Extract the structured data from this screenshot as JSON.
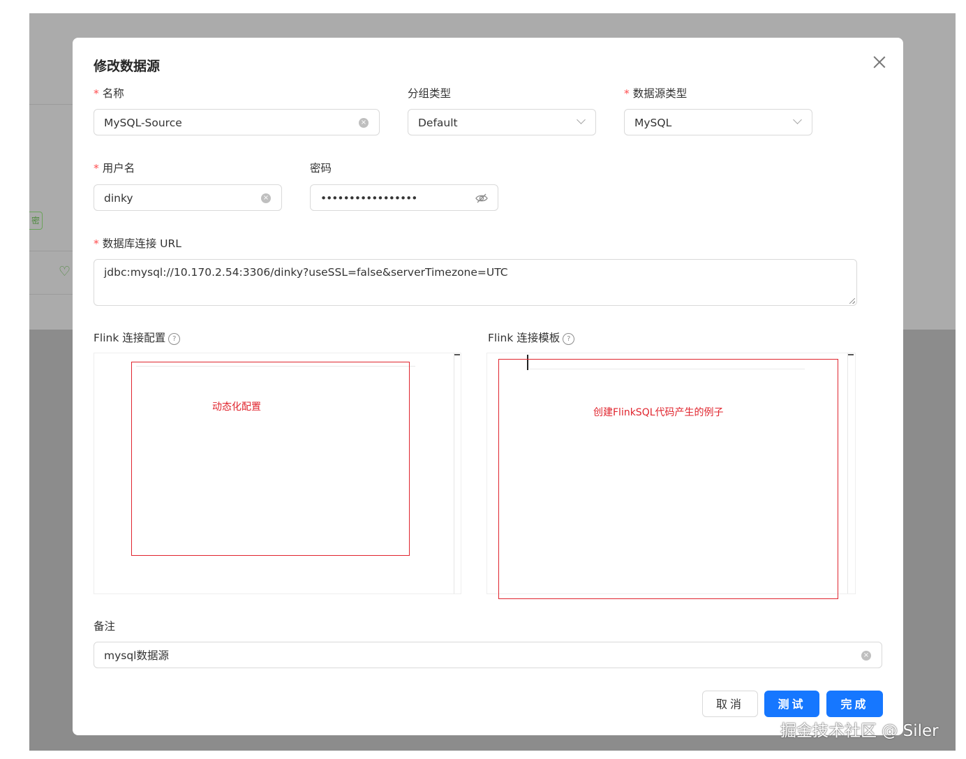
{
  "modal": {
    "title": "修改数据源"
  },
  "fields": {
    "name": {
      "label": "名称",
      "value": "MySQL-Source"
    },
    "group_type": {
      "label": "分组类型",
      "value": "Default"
    },
    "datasource_type": {
      "label": "数据源类型",
      "value": "MySQL"
    },
    "username": {
      "label": "用户名",
      "value": "dinky"
    },
    "password": {
      "label": "密码",
      "value": "•••••••••••••••••"
    },
    "url": {
      "label": "数据库连接 URL",
      "value": "jdbc:mysql://10.170.2.54:3306/dinky?useSSL=false&serverTimezone=UTC"
    },
    "flink_config": {
      "label": "Flink 连接配置",
      "annotation": "动态化配置"
    },
    "flink_template": {
      "label": "Flink 连接模板",
      "annotation": "创建FlinkSQL代码产生的例子"
    },
    "note": {
      "label": "备注",
      "value": "mysql数据源"
    }
  },
  "required_mark": "*",
  "help_glyph": "?",
  "buttons": {
    "cancel": "取消",
    "test": "测试",
    "finish": "完成"
  },
  "background": {
    "tag_text": "密"
  },
  "watermark": "掘金技术社区 @ Siler",
  "colors": {
    "primary": "#1677ff",
    "required": "#ff4d4f",
    "annotation": "#e0242d",
    "overlay": "#8c8c8c"
  },
  "icons": [
    "close-icon",
    "clear-icon",
    "chevron-down-icon",
    "eye-invisible-icon",
    "question-circle-icon",
    "heart-icon"
  ]
}
